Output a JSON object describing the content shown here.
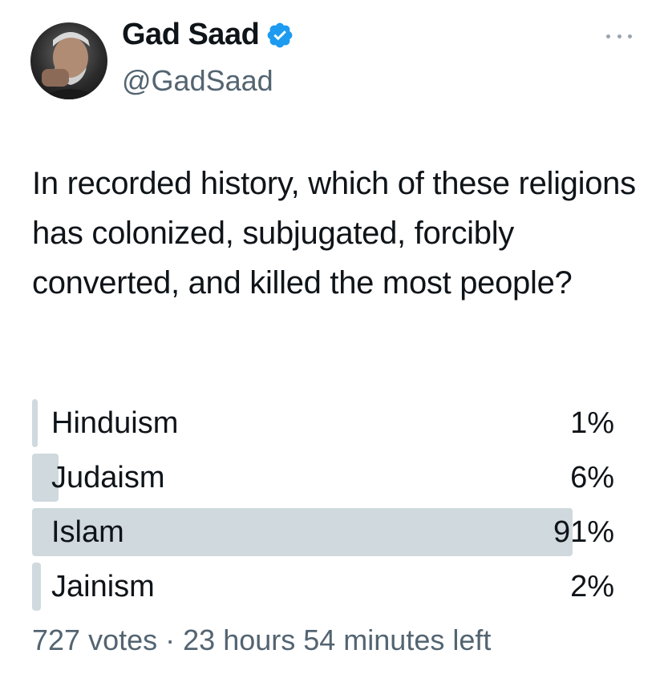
{
  "author": {
    "name": "Gad Saad",
    "handle": "@GadSaad",
    "verified": true,
    "verified_color": "#1d9bf0"
  },
  "tweet": {
    "text": "In recorded history, which of these religions has colonized, subjugated, forcibly converted, and killed the most people?"
  },
  "poll": {
    "bar_color": "#cfd9de",
    "options": [
      {
        "label": "Hinduism",
        "percent": "1%",
        "fraction": 0.01
      },
      {
        "label": "Judaism",
        "percent": "6%",
        "fraction": 0.06
      },
      {
        "label": "Islam",
        "percent": "91%",
        "fraction": 0.91
      },
      {
        "label": "Jainism",
        "percent": "2%",
        "fraction": 0.02
      }
    ],
    "votes": "727 votes",
    "separator": "·",
    "time_left": "23 hours 54 minutes left"
  },
  "icons": {
    "more": "more-options-icon",
    "verified": "verified-badge-icon"
  }
}
